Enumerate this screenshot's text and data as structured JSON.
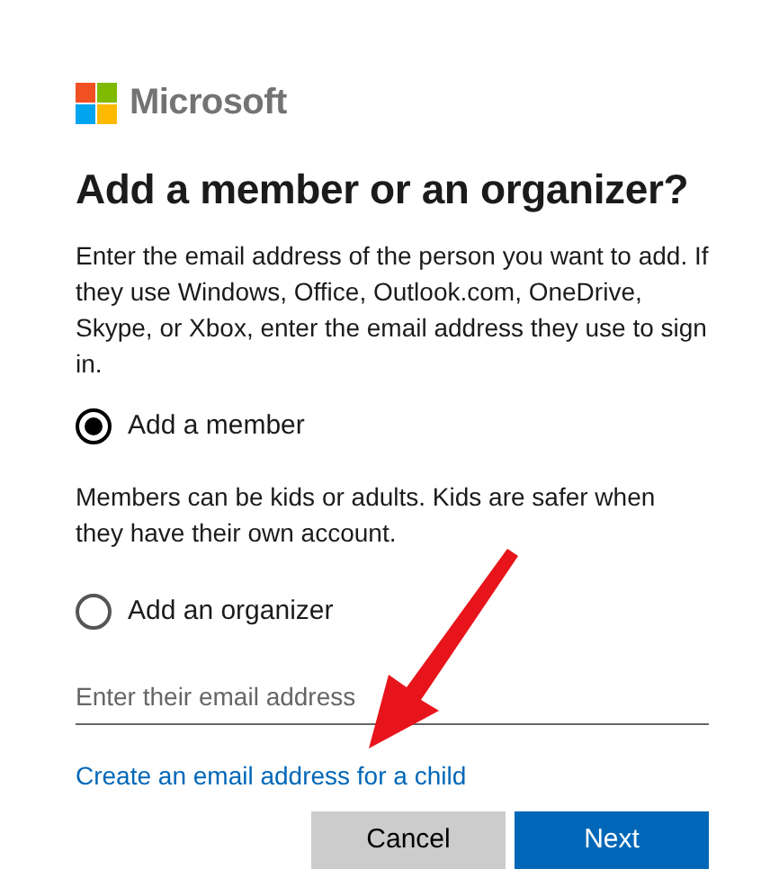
{
  "brand": "Microsoft",
  "heading": "Add a member or an organizer?",
  "intro": "Enter the email address of the person you want to add. If they use Windows, Office, Outlook.com, OneDrive, Skype, or Xbox, enter the email address they use to sign in.",
  "options": [
    {
      "label": "Add a member",
      "selected": true,
      "note": "Members can be kids or adults. Kids are safer when they have their own account."
    },
    {
      "label": "Add an organizer",
      "selected": false
    }
  ],
  "email_field": {
    "placeholder": "Enter their email address"
  },
  "child_link": "Create an email address for a child",
  "buttons": [
    {
      "label": "Cancel",
      "kind": "secondary"
    },
    {
      "label": "Next",
      "kind": "primary"
    }
  ]
}
